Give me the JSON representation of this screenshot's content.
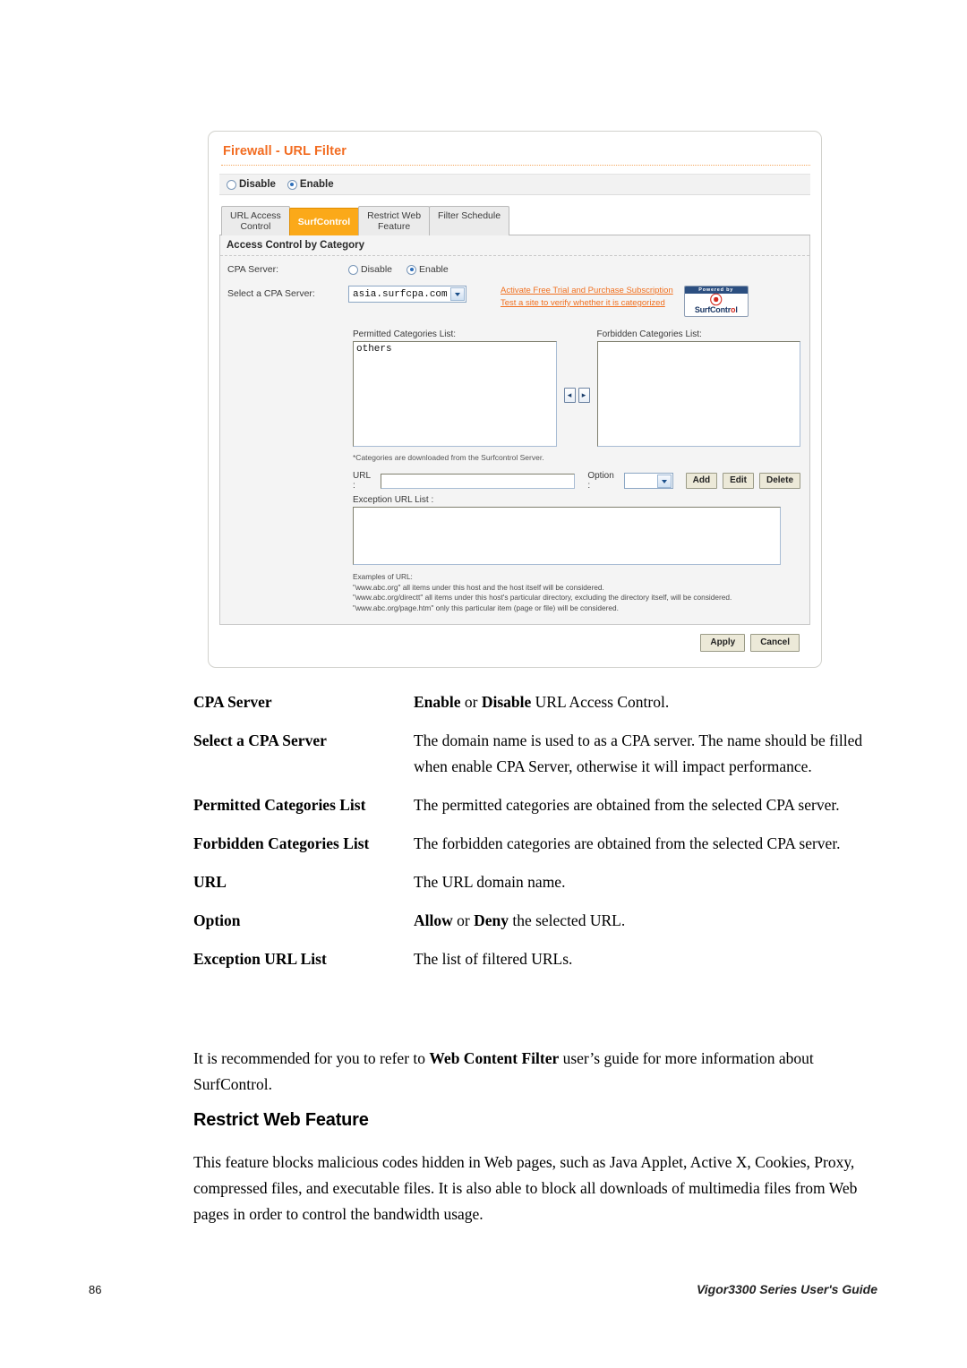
{
  "screenshot": {
    "title": "Firewall - URL Filter",
    "master_switch": {
      "disable_label": "Disable",
      "enable_label": "Enable",
      "selected": "Enable"
    },
    "tabs": [
      {
        "label": "URL Access Control",
        "line1": "URL Access",
        "line2": "Control",
        "active": false
      },
      {
        "label": "SurfControl",
        "line1": "SurfControl",
        "line2": "",
        "active": true
      },
      {
        "label": "Restrict Web Feature",
        "line1": "Restrict Web",
        "line2": "Feature",
        "active": false
      },
      {
        "label": "Filter Schedule",
        "line1": "Filter Schedule",
        "line2": "",
        "active": false
      }
    ],
    "section_title": "Access Control by Category",
    "cpa_server": {
      "label": "CPA Server:",
      "disable_label": "Disable",
      "enable_label": "Enable",
      "selected": "Enable"
    },
    "select_server": {
      "label": "Select a CPA Server:",
      "value": "asia.surfcpa.com"
    },
    "links": [
      "Activate Free Trial and Purchase Subscription",
      "Test a site to verify whether it is categorized"
    ],
    "badge": {
      "powered_by": "Powered by",
      "name_left": "SurfContr",
      "name_mark": "o",
      "name_right": "l",
      "trademark": "®"
    },
    "permitted": {
      "label": "Permitted Categories List:",
      "items": [
        "others"
      ]
    },
    "forbidden": {
      "label": "Forbidden Categories List:",
      "items": []
    },
    "move_left_icon": "◂",
    "move_right_icon": "▸",
    "categories_note": "*Categories are downloaded from the Surfcontrol Server.",
    "url_row": {
      "url_label": "URL :",
      "url_value": "",
      "option_label": "Option :",
      "option_value": "",
      "add_label": "Add",
      "edit_label": "Edit",
      "delete_label": "Delete"
    },
    "exception": {
      "label": "Exception URL List :",
      "value": ""
    },
    "examples": {
      "heading": "Examples of URL:",
      "lines": [
        "\"www.abc.org\" all items under this host and the host itself will be considered.",
        "\"www.abc.org/directt\" all items under this host's particular directory, excluding the directory itself, will be considered.",
        "\"www.abc.org/page.htm\" only this particular item (page or file) will be considered."
      ]
    },
    "apply_label": "Apply",
    "cancel_label": "Cancel",
    "accent_color": "#f26c21",
    "tab_active_color": "#fba919"
  },
  "document": {
    "definitions": [
      {
        "term": "CPA Server",
        "parts": [
          {
            "text": "Enable",
            "bold": true
          },
          {
            "text": " or ",
            "bold": false
          },
          {
            "text": "Disable",
            "bold": true
          },
          {
            "text": " URL Access Control.",
            "bold": false
          }
        ]
      },
      {
        "term": "Select a CPA Server",
        "parts": [
          {
            "text": "The domain name is used to as a CPA server. The name should be filled when enable CPA Server, otherwise it will impact performance.",
            "bold": false
          }
        ]
      },
      {
        "term": "Permitted Categories List",
        "parts": [
          {
            "text": "The permitted categories are obtained from the selected CPA server.",
            "bold": false
          }
        ]
      },
      {
        "term": "Forbidden Categories List",
        "parts": [
          {
            "text": "The forbidden categories are obtained from the selected CPA server.",
            "bold": false
          }
        ]
      },
      {
        "term": "URL",
        "parts": [
          {
            "text": "The URL domain name.",
            "bold": false
          }
        ]
      },
      {
        "term": "Option",
        "parts": [
          {
            "text": "Allow",
            "bold": true
          },
          {
            "text": " or ",
            "bold": false
          },
          {
            "text": "Deny",
            "bold": true
          },
          {
            "text": " the selected URL.",
            "bold": false
          }
        ]
      },
      {
        "term": "Exception URL List",
        "parts": [
          {
            "text": "The list of filtered URLs.",
            "bold": false
          }
        ]
      }
    ],
    "recommend_paragraph": {
      "parts": [
        {
          "text": "It is recommended for you to refer to ",
          "bold": false
        },
        {
          "text": "Web Content Filter",
          "bold": true
        },
        {
          "text": " user’s guide for more information about SurfControl.",
          "bold": false
        }
      ]
    },
    "heading": "Restrict Web Feature",
    "restrict_paragraph": "This feature blocks malicious codes hidden in Web pages, such as Java Applet, Active X, Cookies, Proxy, compressed files, and executable files. It is also able to block all downloads of multimedia files from Web pages in order to control the bandwidth usage.",
    "footer": {
      "page_number": "86",
      "guide": "Vigor3300 Series User's Guide"
    }
  }
}
